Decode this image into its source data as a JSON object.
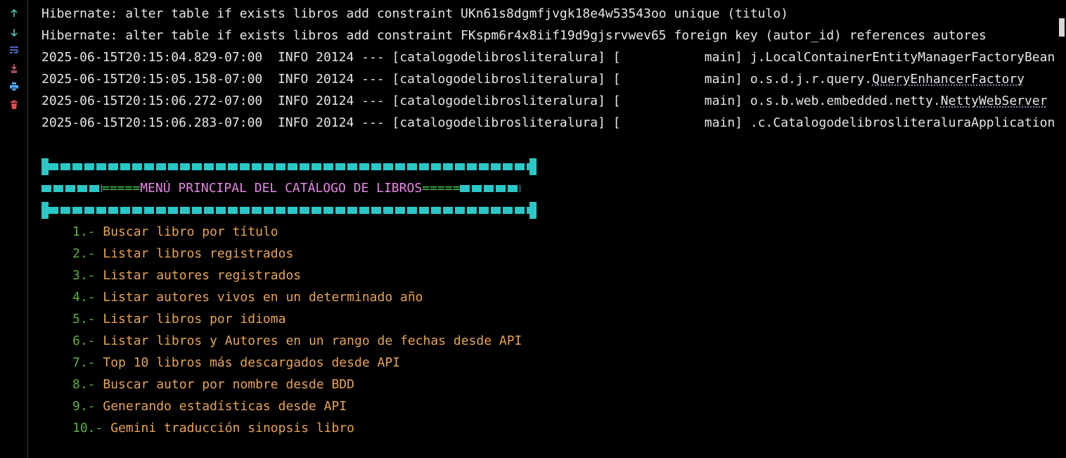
{
  "toolbar": {
    "icons": [
      {
        "name": "scroll-up-icon",
        "color": "#4cc2b8"
      },
      {
        "name": "scroll-down-icon",
        "color": "#4cc2b8"
      },
      {
        "name": "soft-wrap-icon",
        "color": "#6b8cff"
      },
      {
        "name": "scroll-to-end-icon",
        "color": "#e0607a"
      },
      {
        "name": "print-icon",
        "color": "#4aa8ff"
      },
      {
        "name": "clear-all-icon",
        "color": "#e04a4a"
      }
    ]
  },
  "log": {
    "hibernate1": "Hibernate: alter table if exists libros add constraint UKn61s8dgmfjvgk18e4w53543oo unique (titulo)",
    "hibernate2": "Hibernate: alter table if exists libros add constraint FKspm6r4x8iif19d9gjsrvwev65 foreign key (autor_id) references autores",
    "entries": [
      {
        "prefix": "2025-06-15T20:15:04.829-07:00  INFO 20124 --- [catalogodelibrosliteralura] [           main] ",
        "pkg": "j.LocalContainerEntityManagerFactoryBean",
        "cls": ""
      },
      {
        "prefix": "2025-06-15T20:15:05.158-07:00  INFO 20124 --- [catalogodelibrosliteralura] [           main] ",
        "pkg": "o.s.d.j.r.query.",
        "cls": "QueryEnhancerFactory"
      },
      {
        "prefix": "2025-06-15T20:15:06.272-07:00  INFO 20124 --- [catalogodelibrosliteralura] [           main] ",
        "pkg": "o.s.b.web.embedded.netty.",
        "cls": "NettyWebServer"
      },
      {
        "prefix": "2025-06-15T20:15:06.283-07:00  INFO 20124 --- [catalogodelibrosliteralura] [           main] ",
        "pkg": ".c.CatalogodelibrosliteraluraApplication",
        "cls": ""
      }
    ]
  },
  "menu": {
    "title_eq_left": "=====",
    "title_text": "MENÚ PRINCIPAL DEL CATÁLOGO DE LIBROS",
    "title_eq_right": "=====",
    "items": [
      {
        "num": "1.-",
        "label": "Buscar libro por título"
      },
      {
        "num": "2.-",
        "label": "Listar libros registrados"
      },
      {
        "num": "3.-",
        "label": "Listar autores registrados"
      },
      {
        "num": "4.-",
        "label": "Listar autores vivos en un determinado año"
      },
      {
        "num": "5.-",
        "label": "Listar libros por idioma"
      },
      {
        "num": "6.-",
        "label": "Listar libros y Autores en un rango de fechas desde API"
      },
      {
        "num": "7.-",
        "label": "Top 10 libros más descargados desde API"
      },
      {
        "num": "8.-",
        "label": "Buscar autor por nombre desde BDD"
      },
      {
        "num": "9.-",
        "label": "Generando estadísticas desde API"
      },
      {
        "num": "10.-",
        "label": "Gemini traducción sinopsis libro"
      }
    ]
  },
  "colors": {
    "background": "#000000",
    "log_text": "#e6e6e6",
    "accent_cyan": "#2ac7c7",
    "title_magenta": "#e488e4",
    "menu_number_green": "#5fb03f",
    "menu_label_orange": "#e6a455"
  }
}
